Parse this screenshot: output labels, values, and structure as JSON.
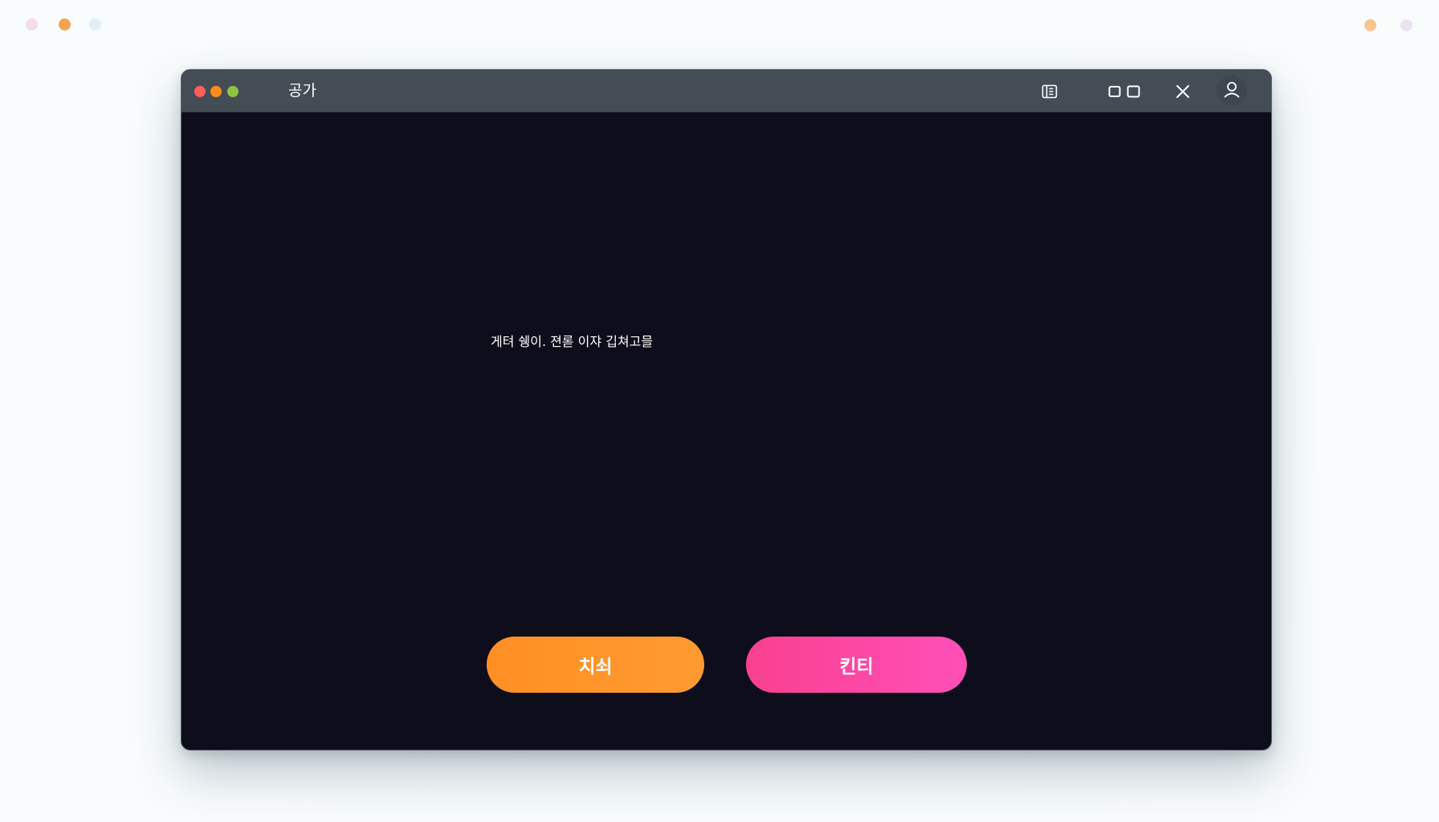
{
  "desktop": {
    "left_dots": [
      {
        "icon": "dot",
        "color": "#f3dde6"
      },
      {
        "icon": "dot",
        "color": "#f5a350"
      },
      {
        "icon": "dot",
        "color": "#e1eef7"
      }
    ],
    "right_dots": [
      {
        "icon": "dot",
        "color": "#f9c48e"
      },
      {
        "icon": "dot",
        "color": "#ece2f0"
      }
    ]
  },
  "window": {
    "title": "공가",
    "traffic_lights": [
      {
        "name": "close",
        "color": "#ff5f57"
      },
      {
        "name": "minimize",
        "color": "#ff8c1a"
      },
      {
        "name": "zoom",
        "color": "#8cc63f"
      }
    ],
    "toolbar": {
      "icons": [
        "sidebar-panel-icon",
        "split-view-icon",
        "close-icon",
        "user-icon"
      ]
    }
  },
  "dialog": {
    "message": "게텨 쉥이. 젼롣 이쟈 깁쳐고믈",
    "cancel_label": "치쇠",
    "confirm_label": "킨티",
    "colors": {
      "background": "#0e0d1b",
      "cancel": "#ff9428",
      "confirm": "#fb47a6"
    }
  }
}
